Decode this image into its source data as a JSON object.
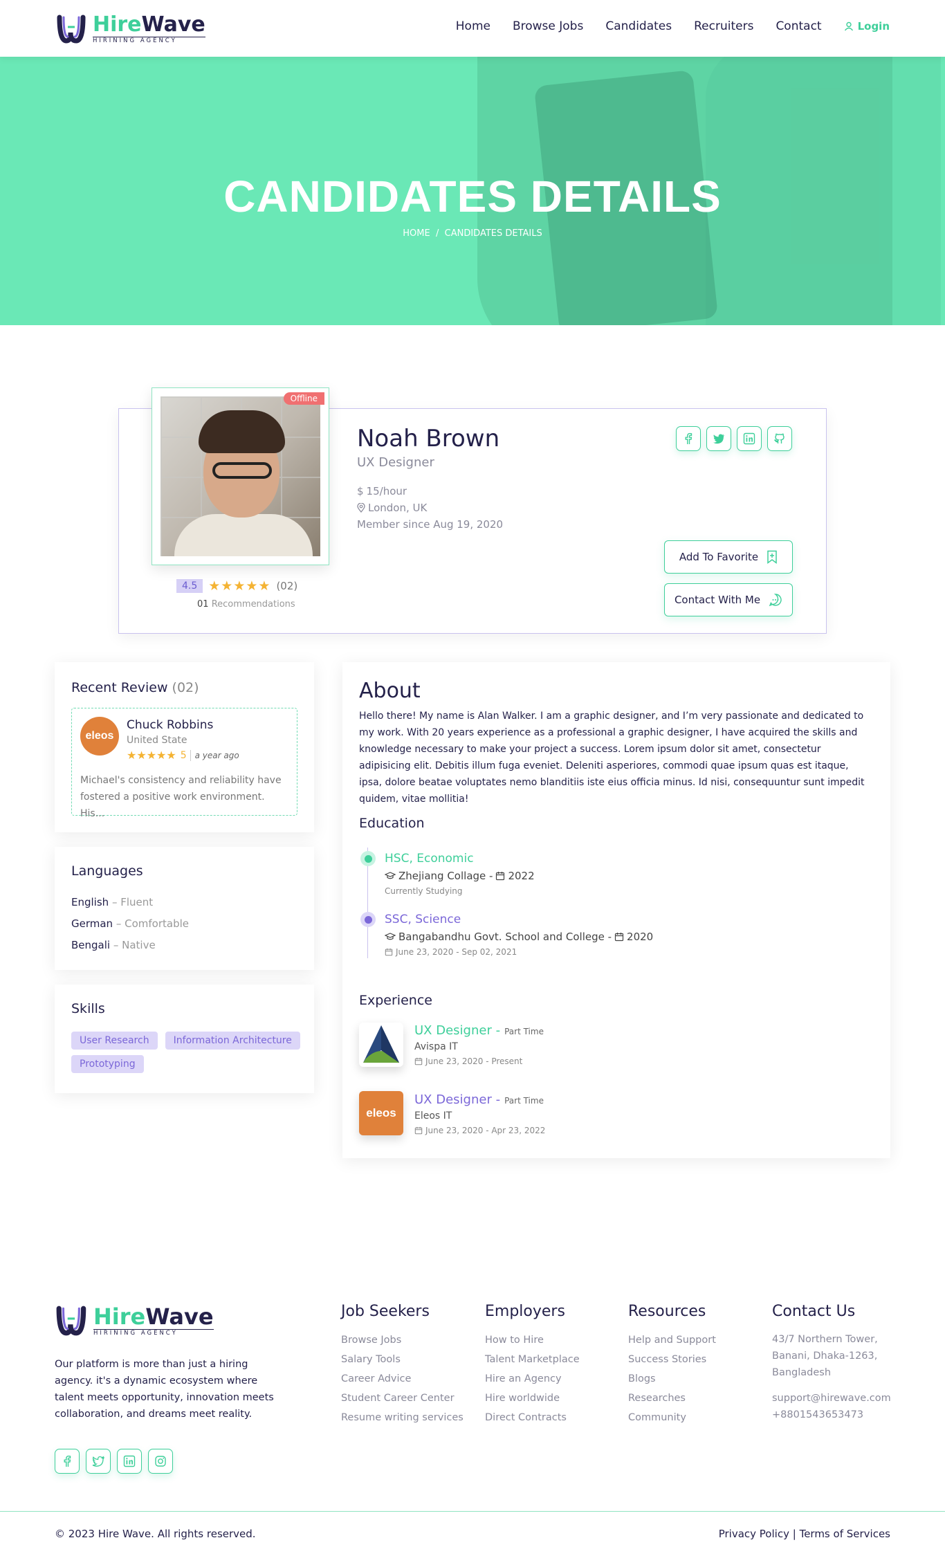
{
  "brand": {
    "name_part1": "Hire",
    "name_part2": "Wave",
    "tagline": "HIRINING AGENCY",
    "accent_color": "#3ecf9a",
    "dark_color": "#24214a",
    "secondary_color": "#7b67d8"
  },
  "nav": {
    "items": [
      "Home",
      "Browse Jobs",
      "Candidates",
      "Recruiters",
      "Contact"
    ],
    "login_label": "Login"
  },
  "hero": {
    "title": "CANDIDATES DETAILS",
    "breadcrumb_home": "HOME",
    "breadcrumb_sep": "/",
    "breadcrumb_current": "CANDIDATES DETAILS"
  },
  "profile": {
    "status": "Offline",
    "name": "Noah Brown",
    "title": "UX Designer",
    "rate": "15/hour",
    "rate_currency": "$",
    "location": "London, UK",
    "member_since": "Member since Aug 19, 2020",
    "rating": "4.5",
    "rating_value": 4.5,
    "rating_stars": "★★★★★",
    "rating_count": "(02)",
    "recommendations_count": "01",
    "recommendations_label": "Recommendations",
    "social_icons": [
      "facebook-icon",
      "twitter-icon",
      "linkedin-icon",
      "github-icon"
    ],
    "add_favorite_label": "Add To Favorite",
    "contact_label": "Contact With Me"
  },
  "recent_review": {
    "title": "Recent Review",
    "count": "(02)",
    "reviewer_logo": "eleos",
    "reviewer_name": "Chuck Robbins",
    "reviewer_location": "United State",
    "stars": "★★★★★",
    "score": "5",
    "time": "a year ago",
    "text": "Michael's consistency and reliability have fostered a positive work environment. His..."
  },
  "languages": {
    "title": "Languages",
    "items": [
      {
        "name": "English",
        "level": "– Fluent"
      },
      {
        "name": "German",
        "level": "– Comfortable"
      },
      {
        "name": "Bengali",
        "level": "– Native"
      }
    ]
  },
  "skills": {
    "title": "Skills",
    "items": [
      "User Research",
      "Information Architecture",
      "Prototyping"
    ]
  },
  "about": {
    "title": "About",
    "text": "Hello there! My name is Alan Walker. I am a graphic designer, and I’m very passionate and dedicated to my work. With 20 years experience as a professional a graphic designer, I have acquired the skills and knowledge necessary to make your project a success. Lorem ipsum dolor sit amet, consectetur adipisicing elit. Debitis illum fuga eveniet. Deleniti asperiores, commodi quae ipsum quas est itaque, ipsa, dolore beatae voluptates nemo blanditiis iste eius officia minus. Id nisi, consequuntur sunt impedit quidem, vitae mollitia!"
  },
  "education": {
    "title": "Education",
    "items": [
      {
        "degree": "HSC, Economic",
        "institution": "Zhejiang Collage -",
        "year": "2022",
        "period": "Currently Studying"
      },
      {
        "degree": "SSC, Science",
        "institution": "Bangabandhu Govt. School and College -",
        "year": "2020",
        "period": "June 23, 2020 - Sep 02, 2021"
      }
    ]
  },
  "experience": {
    "title": "Experience",
    "items": [
      {
        "role": "UX Designer -",
        "type": "Part Time",
        "company": "Avispa IT",
        "period": "June 23, 2020 - Present"
      },
      {
        "role": "UX Designer -",
        "type": "Part Time",
        "company": "Eleos IT",
        "period": "June 23, 2020 - Apr 23, 2022",
        "logo_text": "eleos"
      }
    ]
  },
  "footer": {
    "description": "Our platform is more than just a hiring agency. it's a dynamic ecosystem where talent meets opportunity, innovation meets collaboration, and dreams meet reality.",
    "social_icons": [
      "facebook-icon",
      "twitter-icon",
      "linkedin-icon",
      "instagram-icon"
    ],
    "columns": [
      {
        "title": "Job Seekers",
        "links": [
          "Browse Jobs",
          "Salary Tools",
          "Career Advice",
          "Student Career Center",
          "Resume writing services"
        ]
      },
      {
        "title": "Employers",
        "links": [
          "How to Hire",
          "Talent Marketplace",
          "Hire an Agency",
          "Hire worldwide",
          "Direct Contracts"
        ]
      },
      {
        "title": "Resources",
        "links": [
          "Help and Support",
          "Success Stories",
          "Blogs",
          "Researches",
          "Community"
        ]
      }
    ],
    "contact": {
      "title": "Contact Us",
      "address": "43/7 Northern Tower, Banani, Dhaka-1263, Bangladesh",
      "email": "support@hirewave.com",
      "phone": "+8801543653473"
    },
    "copyright": "© 2023 Hire Wave. All rights reserved.",
    "privacy": "Privacy Policy",
    "legal_sep": "|",
    "terms": "Terms of Services"
  }
}
